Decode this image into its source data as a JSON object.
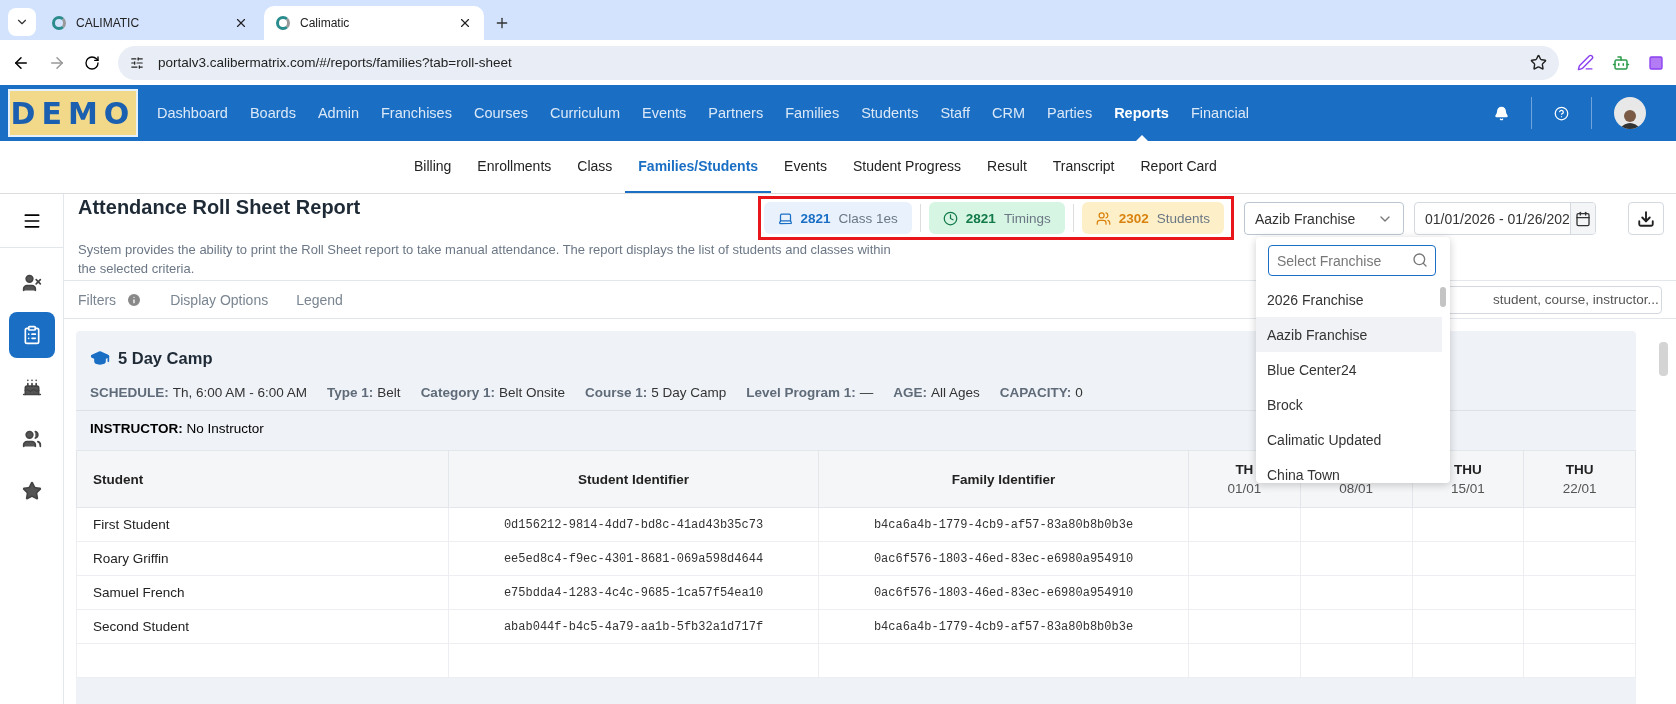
{
  "browser": {
    "tabs": [
      {
        "title": "CALIMATIC",
        "selected": false
      },
      {
        "title": "Calimatic",
        "selected": true
      }
    ],
    "url": "portalv3.calibermatrix.com/#/reports/families?tab=roll-sheet"
  },
  "nav": {
    "logo": "DEMO",
    "items": [
      {
        "label": "Dashboard",
        "selected": false
      },
      {
        "label": "Boards",
        "selected": false
      },
      {
        "label": "Admin",
        "selected": false
      },
      {
        "label": "Franchises",
        "selected": false
      },
      {
        "label": "Courses",
        "selected": false
      },
      {
        "label": "Curriculum",
        "selected": false
      },
      {
        "label": "Events",
        "selected": false
      },
      {
        "label": "Partners",
        "selected": false
      },
      {
        "label": "Families",
        "selected": false
      },
      {
        "label": "Students",
        "selected": false
      },
      {
        "label": "Staff",
        "selected": false
      },
      {
        "label": "CRM",
        "selected": false
      },
      {
        "label": "Parties",
        "selected": false
      },
      {
        "label": "Reports",
        "selected": true
      },
      {
        "label": "Financial",
        "selected": false
      }
    ]
  },
  "subnav": [
    {
      "label": "Billing",
      "selected": false
    },
    {
      "label": "Enrollments",
      "selected": false
    },
    {
      "label": "Class",
      "selected": false
    },
    {
      "label": "Families/Students",
      "selected": true
    },
    {
      "label": "Events",
      "selected": false
    },
    {
      "label": "Student Progress",
      "selected": false
    },
    {
      "label": "Result",
      "selected": false
    },
    {
      "label": "Transcript",
      "selected": false
    },
    {
      "label": "Report Card",
      "selected": false
    }
  ],
  "sidebar": [
    {
      "selected": false
    },
    {
      "selected": true
    },
    {
      "selected": false
    },
    {
      "selected": false
    },
    {
      "selected": false
    }
  ],
  "header": {
    "title": "Attendance Roll Sheet Report",
    "description": "System provides the ability to print the Roll Sheet report to take manual attendance. The report displays the list of students and classes within the selected criteria.",
    "stats": [
      {
        "kind": "classes",
        "count": "2821",
        "label": "Class 1es"
      },
      {
        "kind": "timings",
        "count": "2821",
        "label": "Timings"
      },
      {
        "kind": "students",
        "count": "2302",
        "label": "Students"
      }
    ],
    "franchise_select": {
      "value": "Aazib Franchise",
      "expanded": true
    },
    "date_range": {
      "value": "01/01/2026 - 01/26/202"
    }
  },
  "filter_tabs": [
    {
      "label": "Filters",
      "info": true
    },
    {
      "label": "Display Options",
      "info": false
    },
    {
      "label": "Legend",
      "info": false
    }
  ],
  "search": {
    "placeholder": "student, course, instructor..."
  },
  "franchise_dropdown": {
    "placeholder": "Select Franchise",
    "options": [
      {
        "label": "2026 Franchise",
        "selected": false
      },
      {
        "label": "Aazib Franchise",
        "selected": true
      },
      {
        "label": "Blue Center24",
        "selected": false
      },
      {
        "label": "Brock",
        "selected": false
      },
      {
        "label": "Calimatic Updated",
        "selected": false
      },
      {
        "label": "China Town",
        "selected": false
      }
    ]
  },
  "class_card": {
    "title": "5 Day Camp",
    "details": [
      {
        "label": "SCHEDULE:",
        "value": "Th, 6:00 AM - 6:00 AM"
      },
      {
        "label": "Type 1:",
        "value": "Belt"
      },
      {
        "label": "Category 1:",
        "value": "Belt Onsite"
      },
      {
        "label": "Course 1:",
        "value": "5 Day Camp"
      },
      {
        "label": "Level Program 1:",
        "value": "—"
      },
      {
        "label": "AGE:",
        "value": "All Ages"
      },
      {
        "label": "CAPACITY:",
        "value": "0"
      }
    ],
    "instructor": {
      "label": "INSTRUCTOR:",
      "value": "No Instructor"
    }
  },
  "table": {
    "columns": [
      "Student",
      "Student Identifier",
      "Family Identifier"
    ],
    "date_columns": [
      {
        "day": "TH",
        "date": "01/01"
      },
      {
        "date": "08/01"
      },
      {
        "day": "THU",
        "date": "15/01"
      },
      {
        "day": "THU",
        "date": "22/01"
      }
    ],
    "rows": [
      [
        "First Student",
        "0d156212-9814-4dd7-bd8c-41ad43b35c73",
        "b4ca6a4b-1779-4cb9-af57-83a80b8b0b3e"
      ],
      [
        "Roary Griffin",
        "ee5ed8c4-f9ec-4301-8681-069a598d4644",
        "0ac6f576-1803-46ed-83ec-e6980a954910"
      ],
      [
        "Samuel French",
        "e75bdda4-1283-4c4c-9685-1ca57f54ea10",
        "0ac6f576-1803-46ed-83ec-e6980a954910"
      ],
      [
        "Second Student",
        "abab044f-b4c5-4a79-aa1b-5fb32a1d717f",
        "b4ca6a4b-1779-4cb9-af57-83a80b8b0b3e"
      ]
    ]
  }
}
